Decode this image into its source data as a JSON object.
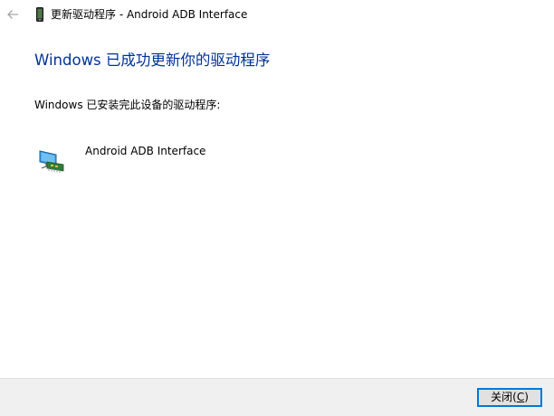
{
  "window": {
    "title": "更新驱动程序 - Android ADB Interface",
    "back_icon": "back-arrow-icon",
    "device_icon": "phone-device-icon"
  },
  "main": {
    "heading": "Windows 已成功更新你的驱动程序",
    "description": "Windows 已安装完此设备的驱动程序:",
    "device": {
      "name": "Android ADB Interface",
      "icon": "network-adapter-icon"
    }
  },
  "footer": {
    "close_label": "关闭",
    "close_shortcut_prefix": "(",
    "close_shortcut_key": "C",
    "close_shortcut_suffix": ")"
  },
  "colors": {
    "heading": "#003399",
    "footer_bg": "#f0f0f0",
    "button_border": "#0078d7",
    "button_bg": "#e1e1e1"
  }
}
